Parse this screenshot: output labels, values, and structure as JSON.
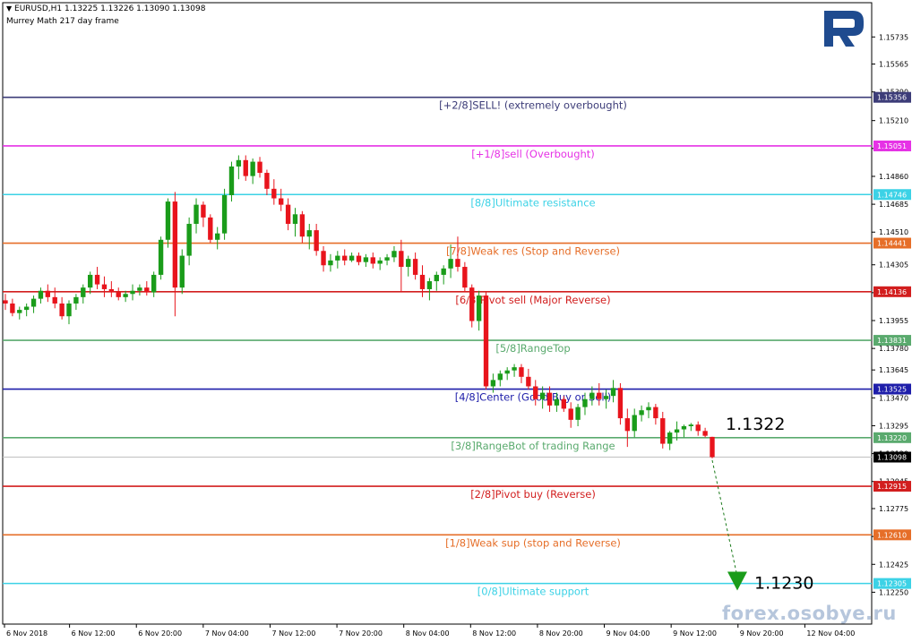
{
  "header": {
    "symbol_line": "EURUSD,H1  1.13225 1.13226 1.13090 1.13098",
    "indicator": "Murrey Math 217 day frame"
  },
  "watermark": "forex.osobye.ru",
  "logo_icon": "roboforex-r-logo",
  "colors": {
    "bull": "#1a9c1a",
    "bear": "#e8141c",
    "logo": "#1f4b8f",
    "target_arrow": "#1a9c1a"
  },
  "chart_data": {
    "type": "candlestick",
    "symbol": "EURUSD",
    "timeframe": "H1",
    "ohlc_last": {
      "open": 1.13225,
      "high": 1.13226,
      "low": 1.1309,
      "close": 1.13098
    },
    "ylim": [
      1.1205,
      1.1595
    ],
    "y_ticks": [
      "1.15735",
      "1.15565",
      "1.15390",
      "1.15210",
      "1.15035",
      "1.14860",
      "1.14685",
      "1.14510",
      "1.14305",
      "1.14130",
      "1.13955",
      "1.13780",
      "1.13645",
      "1.13470",
      "1.13295",
      "1.13120",
      "1.12945",
      "1.12775",
      "1.12600",
      "1.12425",
      "1.12250"
    ],
    "x_ticks": [
      "6 Nov 2018",
      "6 Nov 12:00",
      "6 Nov 20:00",
      "7 Nov 04:00",
      "7 Nov 12:00",
      "7 Nov 20:00",
      "8 Nov 04:00",
      "8 Nov 12:00",
      "8 Nov 20:00",
      "9 Nov 04:00",
      "9 Nov 12:00",
      "9 Nov 20:00",
      "12 Nov 04:00"
    ],
    "levels": [
      {
        "price": 1.15356,
        "price_label": "1.15356",
        "label": "[+2/8]SELL! (extremely overbought)",
        "color": "#3c3c78"
      },
      {
        "price": 1.15051,
        "price_label": "1.15051",
        "label": "[+1/8]sell (Overbought)",
        "color": "#e632e6"
      },
      {
        "price": 1.14746,
        "price_label": "1.14746",
        "label": "[8/8]Ultimate resistance",
        "color": "#3cd2e6"
      },
      {
        "price": 1.14441,
        "price_label": "1.14441",
        "label": "[7/8]Weak res (Stop and Reverse)",
        "color": "#e66e28"
      },
      {
        "price": 1.14136,
        "price_label": "1.14136",
        "label": "[6/8]Pivot sell (Major Reverse)",
        "color": "#d21e1e"
      },
      {
        "price": 1.13831,
        "price_label": "1.13831",
        "label": "[5/8]RangeTop",
        "color": "#5aaa6e"
      },
      {
        "price": 1.13525,
        "price_label": "1.13525",
        "label": "[4/8]Center (Good Buy or Sell)",
        "color": "#1e1eaa"
      },
      {
        "price": 1.1322,
        "price_label": "1.13220",
        "label": "[3/8]RangeBot of trading Range",
        "color": "#5aaa6e"
      },
      {
        "price": 1.12915,
        "price_label": "1.12915",
        "label": "[2/8]Pivot buy (Reverse)",
        "color": "#d21e1e"
      },
      {
        "price": 1.1261,
        "price_label": "1.12610",
        "label": "[1/8]Weak sup (stop and Reverse)",
        "color": "#e66e28"
      },
      {
        "price": 1.12305,
        "price_label": "1.12305",
        "label": "[0/8]Ultimate support",
        "color": "#3cd2e6"
      }
    ],
    "current_price": {
      "price": 1.13098,
      "label": "1.13098"
    },
    "annotations": [
      {
        "text": "1.1322",
        "price": 1.1322
      },
      {
        "text": "1.1230",
        "price": 1.123
      }
    ],
    "candles": [
      [
        1.14082,
        1.14122,
        1.14022,
        1.14062
      ],
      [
        1.14062,
        1.14092,
        1.13982,
        1.14002
      ],
      [
        1.14002,
        1.14042,
        1.13962,
        1.14022
      ],
      [
        1.14022,
        1.14062,
        1.13982,
        1.14042
      ],
      [
        1.14042,
        1.14112,
        1.14002,
        1.14092
      ],
      [
        1.14092,
        1.14162,
        1.14062,
        1.14142
      ],
      [
        1.14142,
        1.14182,
        1.14072,
        1.14102
      ],
      [
        1.14102,
        1.14162,
        1.14032,
        1.14062
      ],
      [
        1.14062,
        1.14102,
        1.13962,
        1.13982
      ],
      [
        1.13982,
        1.14082,
        1.13932,
        1.14062
      ],
      [
        1.14062,
        1.14122,
        1.14022,
        1.14102
      ],
      [
        1.14102,
        1.14182,
        1.14062,
        1.14162
      ],
      [
        1.14162,
        1.14262,
        1.14122,
        1.14242
      ],
      [
        1.14242,
        1.14292,
        1.14152,
        1.14182
      ],
      [
        1.14182,
        1.14232,
        1.14102,
        1.14152
      ],
      [
        1.14152,
        1.14202,
        1.14102,
        1.14132
      ],
      [
        1.14132,
        1.14162,
        1.14082,
        1.14102
      ],
      [
        1.14102,
        1.14142,
        1.14072,
        1.14122
      ],
      [
        1.14122,
        1.14182,
        1.14082,
        1.14142
      ],
      [
        1.14142,
        1.14182,
        1.14112,
        1.14162
      ],
      [
        1.14162,
        1.14202,
        1.14112,
        1.14132
      ],
      [
        1.14132,
        1.14262,
        1.14102,
        1.14242
      ],
      [
        1.14242,
        1.14482,
        1.14212,
        1.14462
      ],
      [
        1.14462,
        1.14722,
        1.14412,
        1.14702
      ],
      [
        1.14702,
        1.14762,
        1.13982,
        1.14162
      ],
      [
        1.14162,
        1.14402,
        1.14122,
        1.14362
      ],
      [
        1.14362,
        1.14602,
        1.14302,
        1.14562
      ],
      [
        1.14562,
        1.14722,
        1.14502,
        1.14682
      ],
      [
        1.14682,
        1.14702,
        1.14542,
        1.14602
      ],
      [
        1.14602,
        1.14622,
        1.14442,
        1.14462
      ],
      [
        1.14462,
        1.14542,
        1.14402,
        1.14502
      ],
      [
        1.14502,
        1.14782,
        1.14462,
        1.14742
      ],
      [
        1.14742,
        1.14952,
        1.14702,
        1.14922
      ],
      [
        1.14922,
        1.14992,
        1.14842,
        1.14962
      ],
      [
        1.14962,
        1.14992,
        1.14832,
        1.14862
      ],
      [
        1.14862,
        1.14972,
        1.14812,
        1.14952
      ],
      [
        1.14952,
        1.14982,
        1.14852,
        1.14882
      ],
      [
        1.14882,
        1.14902,
        1.14742,
        1.14782
      ],
      [
        1.14782,
        1.14842,
        1.14682,
        1.14722
      ],
      [
        1.14722,
        1.14782,
        1.14642,
        1.14682
      ],
      [
        1.14682,
        1.14722,
        1.14522,
        1.14562
      ],
      [
        1.14562,
        1.14662,
        1.14482,
        1.14622
      ],
      [
        1.14622,
        1.14642,
        1.14442,
        1.14482
      ],
      [
        1.14482,
        1.14562,
        1.14402,
        1.14522
      ],
      [
        1.14522,
        1.14562,
        1.14362,
        1.14392
      ],
      [
        1.14392,
        1.14422,
        1.14262,
        1.14302
      ],
      [
        1.14302,
        1.14372,
        1.14262,
        1.14332
      ],
      [
        1.14332,
        1.14392,
        1.14282,
        1.14362
      ],
      [
        1.14362,
        1.14402,
        1.14302,
        1.14332
      ],
      [
        1.14332,
        1.14382,
        1.14322,
        1.14362
      ],
      [
        1.14362,
        1.14382,
        1.14302,
        1.14322
      ],
      [
        1.14322,
        1.14372,
        1.14292,
        1.14352
      ],
      [
        1.14352,
        1.14382,
        1.14282,
        1.14312
      ],
      [
        1.14312,
        1.14352,
        1.14272,
        1.14332
      ],
      [
        1.14332,
        1.14372,
        1.14302,
        1.14352
      ],
      [
        1.14352,
        1.14422,
        1.14322,
        1.14392
      ],
      [
        1.14392,
        1.14462,
        1.14132,
        1.14292
      ],
      [
        1.14292,
        1.14362,
        1.14232,
        1.14342
      ],
      [
        1.14342,
        1.14382,
        1.14212,
        1.14242
      ],
      [
        1.14242,
        1.14302,
        1.14102,
        1.14152
      ],
      [
        1.14152,
        1.14222,
        1.14082,
        1.14202
      ],
      [
        1.14202,
        1.14262,
        1.14142,
        1.14242
      ],
      [
        1.14242,
        1.14302,
        1.14182,
        1.14282
      ],
      [
        1.14282,
        1.14432,
        1.14222,
        1.14342
      ],
      [
        1.14342,
        1.14482,
        1.14262,
        1.14292
      ],
      [
        1.14292,
        1.14322,
        1.14132,
        1.14162
      ],
      [
        1.14162,
        1.14182,
        1.13912,
        1.13952
      ],
      [
        1.13952,
        1.14142,
        1.13892,
        1.14112
      ],
      [
        1.14112,
        1.14132,
        1.13522,
        1.13542
      ],
      [
        1.13542,
        1.13622,
        1.13502,
        1.13582
      ],
      [
        1.13582,
        1.13642,
        1.13542,
        1.13622
      ],
      [
        1.13622,
        1.13662,
        1.13582,
        1.13642
      ],
      [
        1.13642,
        1.13682,
        1.13602,
        1.13662
      ],
      [
        1.13662,
        1.13682,
        1.13562,
        1.13602
      ],
      [
        1.13602,
        1.13652,
        1.13522,
        1.13542
      ],
      [
        1.13542,
        1.13582,
        1.13422,
        1.13462
      ],
      [
        1.13462,
        1.13542,
        1.13402,
        1.13502
      ],
      [
        1.13502,
        1.13542,
        1.13382,
        1.13422
      ],
      [
        1.13422,
        1.13502,
        1.13382,
        1.13462
      ],
      [
        1.13462,
        1.13482,
        1.13382,
        1.13402
      ],
      [
        1.13402,
        1.13442,
        1.13282,
        1.13332
      ],
      [
        1.13332,
        1.13432,
        1.13292,
        1.13412
      ],
      [
        1.13412,
        1.13502,
        1.13362,
        1.13462
      ],
      [
        1.13462,
        1.13542,
        1.13422,
        1.13502
      ],
      [
        1.13502,
        1.13562,
        1.13422,
        1.13462
      ],
      [
        1.13462,
        1.13522,
        1.13402,
        1.13482
      ],
      [
        1.13482,
        1.13582,
        1.13442,
        1.13532
      ],
      [
        1.13532,
        1.13562,
        1.13302,
        1.13342
      ],
      [
        1.13342,
        1.13402,
        1.13162,
        1.13262
      ],
      [
        1.13262,
        1.13402,
        1.13222,
        1.13362
      ],
      [
        1.13362,
        1.13422,
        1.13322,
        1.13392
      ],
      [
        1.13392,
        1.13442,
        1.13342,
        1.13412
      ],
      [
        1.13412,
        1.13432,
        1.13302,
        1.13342
      ],
      [
        1.13342,
        1.13382,
        1.13152,
        1.13182
      ],
      [
        1.13182,
        1.13262,
        1.13142,
        1.13252
      ],
      [
        1.13252,
        1.13322,
        1.13202,
        1.13272
      ],
      [
        1.13272,
        1.13302,
        1.13222,
        1.13292
      ],
      [
        1.13292,
        1.13312,
        1.13262,
        1.13302
      ],
      [
        1.13302,
        1.13322,
        1.13232,
        1.13262
      ],
      [
        1.13262,
        1.13282,
        1.13222,
        1.13232
      ],
      [
        1.13225,
        1.13226,
        1.1309,
        1.13098
      ]
    ]
  }
}
